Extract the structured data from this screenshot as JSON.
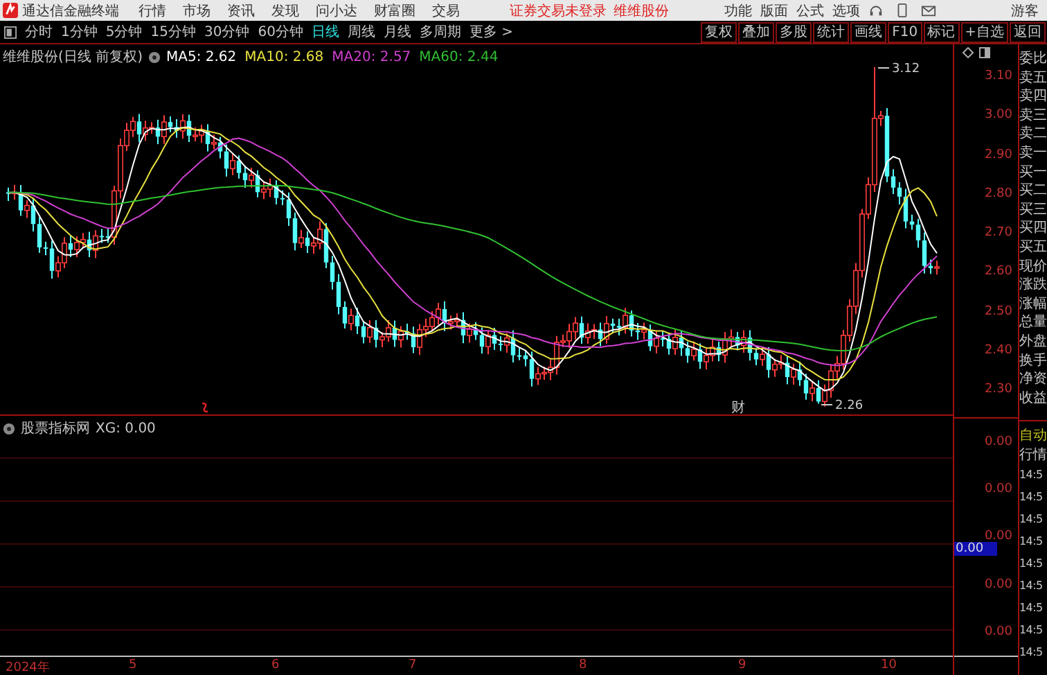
{
  "app_bar": {
    "app_name": "通达信金融终端",
    "menus": [
      "行情",
      "市场",
      "资讯",
      "发现",
      "问小达",
      "财富圈",
      "交易"
    ],
    "login_notice": "证券交易未登录",
    "stock_name": "维维股份",
    "tools": [
      "功能",
      "版面",
      "公式",
      "选项"
    ],
    "user": "游客"
  },
  "period_bar": {
    "periods": [
      {
        "label": "分时",
        "selected": false
      },
      {
        "label": "1分钟",
        "selected": false
      },
      {
        "label": "5分钟",
        "selected": false
      },
      {
        "label": "15分钟",
        "selected": false
      },
      {
        "label": "30分钟",
        "selected": false
      },
      {
        "label": "60分钟",
        "selected": false
      },
      {
        "label": "日线",
        "selected": true
      },
      {
        "label": "周线",
        "selected": false
      },
      {
        "label": "月线",
        "selected": false
      },
      {
        "label": "多周期",
        "selected": false
      }
    ],
    "more": "更多 >",
    "actions": [
      "复权",
      "叠加",
      "多股",
      "统计",
      "画线",
      "F10",
      "标记",
      "+自选",
      "返回"
    ]
  },
  "main_chart": {
    "title": "维维股份(日线 前复权)",
    "indicators": [
      {
        "label": "MA5: 2.62",
        "color": "#ffffff"
      },
      {
        "label": "MA10: 2.68",
        "color": "#e8e040"
      },
      {
        "label": "MA20: 2.57",
        "color": "#d040d0"
      },
      {
        "label": "MA60: 2.44",
        "color": "#30c030"
      }
    ],
    "y_labels": [
      "3.10",
      "3.00",
      "2.90",
      "2.80",
      "2.70",
      "2.60",
      "2.50",
      "2.40",
      "2.30"
    ],
    "high_label": "3.12",
    "low_label": "2.26",
    "event_marker": "财"
  },
  "sub_chart": {
    "title": "股票指标网",
    "reading": "XG: 0.00",
    "y_labels": [
      "0.00",
      "0.00",
      "0.00",
      "0.00",
      "0.00"
    ],
    "cursor_value": "0.00"
  },
  "side_panel": {
    "quote_labels": [
      "委比",
      "卖五",
      "卖四",
      "卖三",
      "卖二",
      "卖一",
      "买一",
      "买二",
      "买三",
      "买四",
      "买五",
      "现价",
      "涨跌",
      "涨幅",
      "总量",
      "外盘",
      "换手",
      "净资",
      "收益"
    ],
    "mode": "自动",
    "mode_2": "行情",
    "trades": [
      "14:5",
      "14:5",
      "14:5",
      "14:5",
      "14:5",
      "14:5",
      "14:5",
      "14:5",
      "14:5"
    ]
  },
  "x_axis": [
    "2024年",
    "5",
    "6",
    "7",
    "8",
    "9",
    "10"
  ]
}
